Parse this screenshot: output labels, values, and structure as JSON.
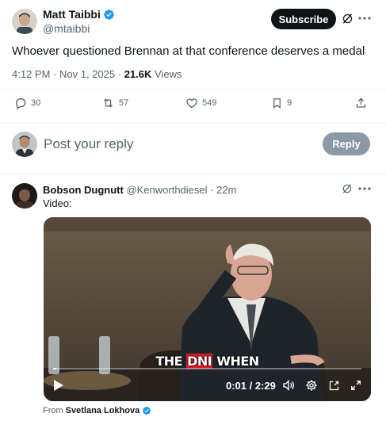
{
  "post": {
    "author_name": "Matt Taibbi",
    "author_handle": "@mtaibbi",
    "subscribe_label": "Subscribe",
    "text": "Whoever questioned Brennan at that conference deserves a medal",
    "time": "4:12 PM",
    "separator": "·",
    "date": "Nov 1, 2025",
    "views_count": "21.6K",
    "views_label": "Views",
    "replies": "30",
    "reposts": "57",
    "likes": "549",
    "bookmarks": "9"
  },
  "compose": {
    "placeholder": "Post your reply",
    "reply_label": "Reply"
  },
  "reply": {
    "author_name": "Bobson Dugnutt",
    "author_handle": "@Kenworthdiesel",
    "age": "· 22m",
    "text": "Video:",
    "video": {
      "caption_pre": "THE ",
      "caption_highlight": "DNI",
      "caption_post": " WHEN",
      "time": "0:01 / 2:29",
      "progress_fraction": 0.01
    },
    "from_label": "From",
    "from_name": "Svetlana Lokhova"
  },
  "colors": {
    "verified": "#1d9bf0",
    "text": "#0f1419",
    "secondary": "#536471",
    "caption_highlight": "#e11d2a"
  }
}
